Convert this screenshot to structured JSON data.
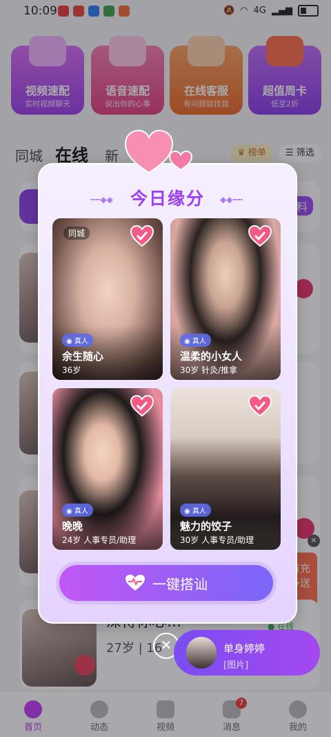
{
  "status": {
    "time": "10:09",
    "network": "4G"
  },
  "features": [
    {
      "title": "视频速配",
      "sub": "实时视频聊天",
      "color": "#b83ff0"
    },
    {
      "title": "语音速配",
      "sub": "说出你的心事",
      "color": "#ec4b8a"
    },
    {
      "title": "在线客服",
      "sub": "有问题就找我",
      "color": "#f07a2c"
    },
    {
      "title": "超值周卡",
      "sub": "低至2折",
      "color": "#c33ff2"
    }
  ],
  "tabs": {
    "city": "同城",
    "online": "在线",
    "new": "新",
    "rank": "榜单",
    "filter": "筛选"
  },
  "background": {
    "profile_btn": "料",
    "promo": [
      "首充",
      "多送"
    ],
    "list_name": "深得你心...",
    "list_info": "27岁 | 16",
    "online_status": "在线"
  },
  "modal": {
    "title": "今日缘分",
    "profiles": [
      {
        "location": "同城",
        "verify": "真人",
        "name": "余生随心",
        "info": "36岁"
      },
      {
        "location": "",
        "verify": "真人",
        "name": "温柔的小女人",
        "info": "30岁 针灸/推拿"
      },
      {
        "location": "",
        "verify": "真人",
        "name": "晚晚",
        "info": "24岁 人事专员/助理"
      },
      {
        "location": "",
        "verify": "真人",
        "name": "魅力的饺子",
        "info": "30岁 人事专员/助理"
      }
    ],
    "cta": "一键搭讪",
    "close": "✕"
  },
  "float_chat": {
    "name": "单身婷婷",
    "message": "[图片]"
  },
  "nav": [
    {
      "label": "首页",
      "active": true
    },
    {
      "label": "动态"
    },
    {
      "label": "视频"
    },
    {
      "label": "消息",
      "badge": "7"
    },
    {
      "label": "我的"
    }
  ]
}
